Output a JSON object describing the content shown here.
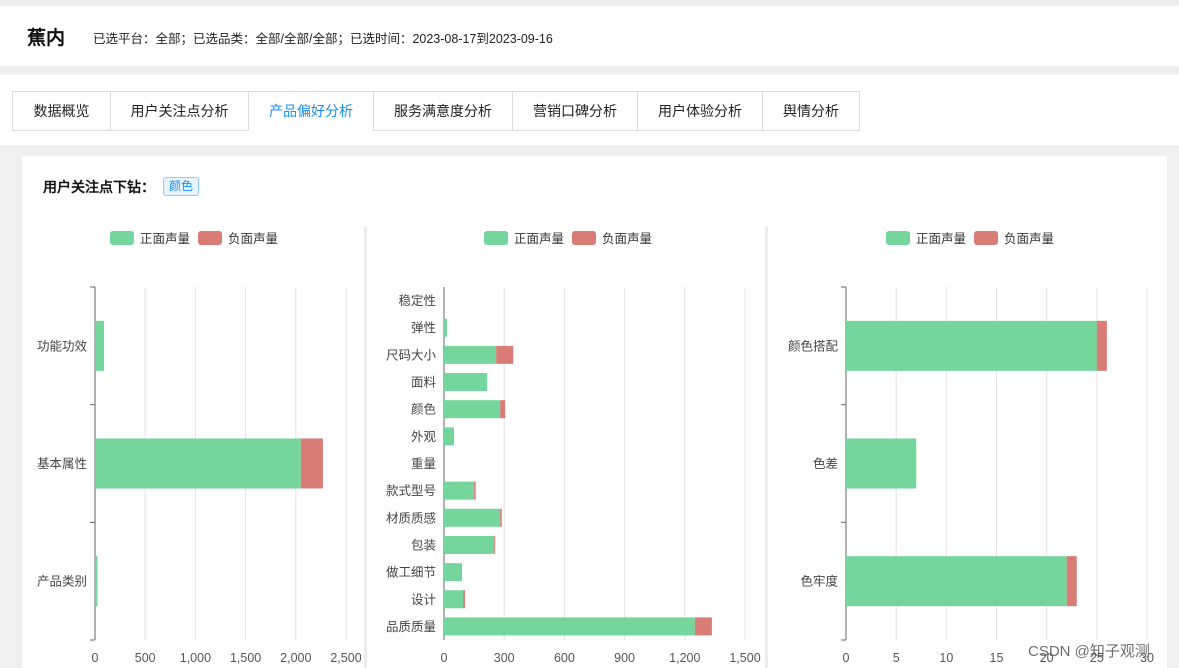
{
  "header": {
    "brand": "蕉内",
    "filters": "已选平台：全部；已选品类：全部/全部/全部；已选时间：2023-08-17到2023-09-16"
  },
  "tabs": [
    {
      "label": "数据概览",
      "active": false
    },
    {
      "label": "用户关注点分析",
      "active": false
    },
    {
      "label": "产品偏好分析",
      "active": true
    },
    {
      "label": "服务满意度分析",
      "active": false
    },
    {
      "label": "营销口碑分析",
      "active": false
    },
    {
      "label": "用户体验分析",
      "active": false
    },
    {
      "label": "舆情分析",
      "active": false
    }
  ],
  "drilldown": {
    "title": "用户关注点下钻：",
    "tag": "颜色"
  },
  "colors": {
    "positive": "#74d59d",
    "negative": "#d97c76",
    "accent": "#1890ff"
  },
  "chart_data": [
    {
      "type": "bar",
      "orientation": "horizontal",
      "stacked": true,
      "legend": [
        "正面声量",
        "负面声量"
      ],
      "legend_position": "top-center",
      "categories": [
        "功能功效",
        "基本属性",
        "产品类别"
      ],
      "series": [
        {
          "name": "正面声量",
          "values": [
            90,
            2050,
            25
          ]
        },
        {
          "name": "负面声量",
          "values": [
            0,
            220,
            0
          ]
        }
      ],
      "xlim": [
        0,
        2500
      ],
      "xticks": [
        "0",
        "500",
        "1,000",
        "1,500",
        "2,000",
        "2,500"
      ],
      "grid": true
    },
    {
      "type": "bar",
      "orientation": "horizontal",
      "stacked": true,
      "legend": [
        "正面声量",
        "负面声量"
      ],
      "legend_position": "top-center",
      "categories": [
        "稳定性",
        "弹性",
        "尺码大小",
        "面料",
        "颜色",
        "外观",
        "重量",
        "款式型号",
        "材质质感",
        "包装",
        "做工细节",
        "设计",
        "品质质量"
      ],
      "series": [
        {
          "name": "正面声量",
          "values": [
            0,
            15,
            260,
            215,
            280,
            50,
            0,
            150,
            280,
            250,
            90,
            95,
            1250
          ]
        },
        {
          "name": "负面声量",
          "values": [
            0,
            0,
            85,
            0,
            25,
            0,
            0,
            8,
            8,
            5,
            0,
            10,
            85
          ]
        }
      ],
      "xlim": [
        0,
        1500
      ],
      "xticks": [
        "0",
        "300",
        "600",
        "900",
        "1,200",
        "1,500"
      ],
      "grid": true
    },
    {
      "type": "bar",
      "orientation": "horizontal",
      "stacked": true,
      "legend": [
        "正面声量",
        "负面声量"
      ],
      "legend_position": "top-center",
      "categories": [
        "颜色搭配",
        "色差",
        "色牢度"
      ],
      "series": [
        {
          "name": "正面声量",
          "values": [
            25,
            7,
            22
          ]
        },
        {
          "name": "负面声量",
          "values": [
            1,
            0,
            1
          ]
        }
      ],
      "xlim": [
        0,
        30
      ],
      "xticks": [
        "0",
        "5",
        "10",
        "15",
        "20",
        "25",
        "30"
      ],
      "grid": true
    }
  ],
  "watermark": "CSDN @知子观测"
}
